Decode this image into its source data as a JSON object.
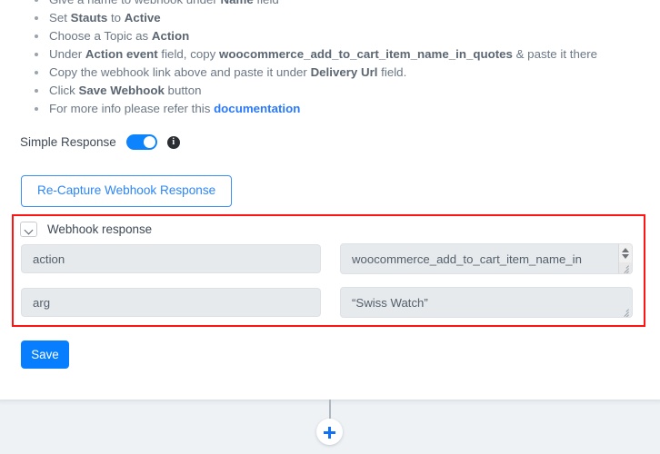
{
  "instructions": [
    {
      "prefix": "Give a name to webhook under ",
      "bold": "Name",
      "suffix": " field"
    },
    {
      "prefix": "Set ",
      "bold": "Stauts",
      "mid": " to ",
      "bold2": "Active",
      "suffix": ""
    },
    {
      "prefix": "Choose a Topic as ",
      "bold": "Action",
      "suffix": ""
    },
    {
      "prefix": "Under ",
      "bold": "Action event",
      "mid": " field, copy ",
      "bold2": "woocommerce_add_to_cart_item_name_in_quotes",
      "suffix": " & paste it there"
    },
    {
      "prefix": "Copy the webhook link above and paste it under ",
      "bold": "Delivery Url",
      "suffix": " field."
    },
    {
      "prefix": "Click ",
      "bold": "Save Webhook",
      "suffix": " button"
    },
    {
      "prefix": "For more info please refer this ",
      "link": "documentation",
      "suffix": ""
    }
  ],
  "simple_response": {
    "label": "Simple Response",
    "toggle_state": "on",
    "info_glyph": "i"
  },
  "recapture": {
    "label": "Re-Capture Webhook Response"
  },
  "webhook_response": {
    "title": "Webhook response",
    "rows": [
      {
        "key": "action",
        "value": "woocommerce_add_to_cart_item_name_in"
      },
      {
        "key": "arg",
        "value": "“Swiss Watch”"
      }
    ]
  },
  "save": {
    "label": "Save"
  },
  "colors": {
    "accent_blue": "#067efd",
    "link_blue": "#2979ff",
    "highlight_red": "#ff1414",
    "field_gray": "#e6eaed",
    "page_bg": "#eef2f5"
  }
}
